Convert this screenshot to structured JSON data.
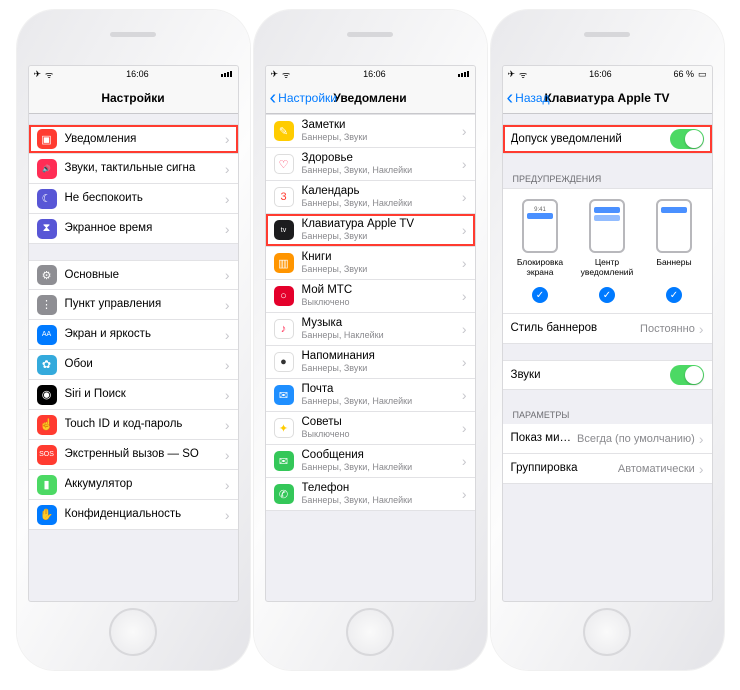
{
  "status": {
    "time": "16:06",
    "battery": "66 %"
  },
  "phone1": {
    "title": "Настройки",
    "grp1": [
      {
        "icon": "#ff3b30",
        "glyph": "▣",
        "label": "Уведомления",
        "hl": true
      },
      {
        "icon": "#ff2d55",
        "glyph": "🔊",
        "label": "Звуки, тактильные сигна"
      },
      {
        "icon": "#5856d6",
        "glyph": "☾",
        "label": "Не беспокоить"
      },
      {
        "icon": "#5856d6",
        "glyph": "⧗",
        "label": "Экранное время"
      }
    ],
    "grp2": [
      {
        "icon": "#8e8e93",
        "glyph": "⚙",
        "label": "Основные"
      },
      {
        "icon": "#8e8e93",
        "glyph": "⋮",
        "label": "Пункт управления"
      },
      {
        "icon": "#007aff",
        "glyph": "AA",
        "label": "Экран и яркость"
      },
      {
        "icon": "#34aadc",
        "glyph": "✿",
        "label": "Обои"
      },
      {
        "icon": "#000000",
        "glyph": "◉",
        "label": "Siri и Поиск"
      },
      {
        "icon": "#ff3b30",
        "glyph": "☝",
        "label": "Touch ID и код-пароль"
      },
      {
        "icon": "#ff3b30",
        "glyph": "SOS",
        "label": "Экстренный вызов — SO"
      },
      {
        "icon": "#4cd964",
        "glyph": "▮",
        "label": "Аккумулятор"
      },
      {
        "icon": "#007aff",
        "glyph": "✋",
        "label": "Конфиденциальность"
      }
    ]
  },
  "phone2": {
    "back": "Настройки",
    "title": "Уведомлени",
    "items": [
      {
        "icon": "#ffcc00",
        "glyph": "✎",
        "label": "Заметки",
        "sub": "Баннеры, Звуки"
      },
      {
        "icon": "#ffffff",
        "glyph": "♡",
        "label": "Здоровье",
        "sub": "Баннеры, Звуки, Наклейки",
        "fg": "#ff2d55",
        "bd": "#ddd"
      },
      {
        "icon": "#ffffff",
        "glyph": "3",
        "label": "Календарь",
        "sub": "Баннеры, Звуки, Наклейки",
        "fg": "#ff3b30",
        "bd": "#ddd"
      },
      {
        "icon": "#1c1c1e",
        "glyph": "tv",
        "label": "Клавиатура Apple TV",
        "sub": "Баннеры, Звуки",
        "hl": true
      },
      {
        "icon": "#ff9500",
        "glyph": "▥",
        "label": "Книги",
        "sub": "Баннеры, Звуки"
      },
      {
        "icon": "#e4002b",
        "glyph": "○",
        "label": "Мой МТС",
        "sub": "Выключено"
      },
      {
        "icon": "#ffffff",
        "glyph": "♪",
        "label": "Музыка",
        "sub": "Баннеры, Наклейки",
        "fg": "#ff2d55",
        "bd": "#ddd"
      },
      {
        "icon": "#ffffff",
        "glyph": "●",
        "label": "Напоминания",
        "sub": "Баннеры, Звуки",
        "fg": "#333",
        "bd": "#ddd"
      },
      {
        "icon": "#1f8fff",
        "glyph": "✉",
        "label": "Почта",
        "sub": "Баннеры, Звуки, Наклейки"
      },
      {
        "icon": "#ffffff",
        "glyph": "✦",
        "label": "Советы",
        "sub": "Выключено",
        "fg": "#ffcc00",
        "bd": "#ddd"
      },
      {
        "icon": "#34c759",
        "glyph": "✉",
        "label": "Сообщения",
        "sub": "Баннеры, Звуки, Наклейки"
      },
      {
        "icon": "#34c759",
        "glyph": "✆",
        "label": "Телефон",
        "sub": "Баннеры, Звуки, Наклейки"
      }
    ]
  },
  "phone3": {
    "back": "Назад",
    "title": "Клавиатура Apple TV",
    "allow": "Допуск уведомлений",
    "alerts_header": "ПРЕДУПРЕЖДЕНИЯ",
    "alert_types": [
      "Блокировка экрана",
      "Центр уведомлений",
      "Баннеры"
    ],
    "banner_style_label": "Стиль баннеров",
    "banner_style_value": "Постоянно",
    "sounds": "Звуки",
    "params_header": "ПАРАМЕТРЫ",
    "preview_label": "Показ миниатюр",
    "preview_value": "Всегда (по умолчанию)",
    "grouping_label": "Группировка",
    "grouping_value": "Автоматически"
  }
}
